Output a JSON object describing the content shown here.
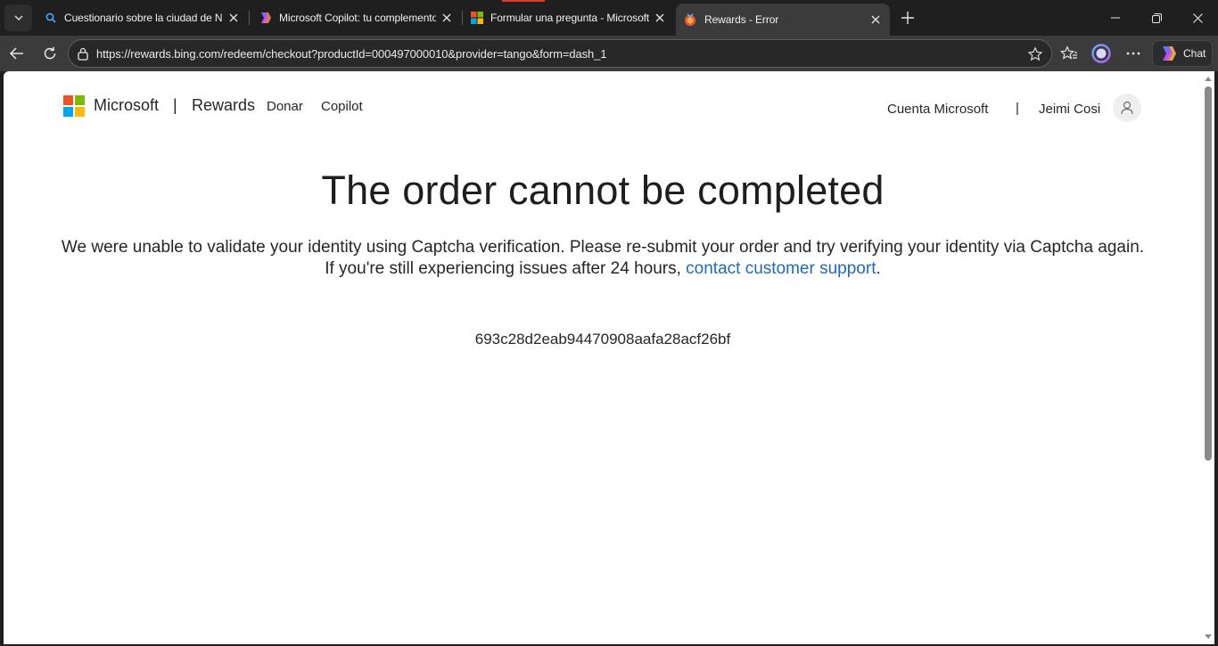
{
  "browser": {
    "tabs": [
      {
        "title": "Cuestionario sobre la ciudad de Nueva York",
        "icon": "bing-search-icon",
        "active": false
      },
      {
        "title": "Microsoft Copilot: tu complemento de IA",
        "icon": "copilot-icon",
        "active": false
      },
      {
        "title": "Formular una pregunta - Microsoft Community",
        "icon": "microsoft-logo-icon",
        "active": false
      },
      {
        "title": "Rewards - Error",
        "icon": "rewards-icon",
        "active": true
      }
    ],
    "address": {
      "url": "https://rewards.bing.com/redeem/checkout?productId=000497000010&provider=tango&form=dash_1"
    },
    "chat_label": "Chat"
  },
  "site": {
    "brand": "Microsoft",
    "separator": "|",
    "nav": {
      "rewards": "Rewards",
      "donar": "Donar",
      "copilot": "Copilot"
    },
    "account": {
      "link": "Cuenta Microsoft",
      "separator": "|",
      "user_name": "Jeimi Cosi"
    },
    "logo_colors": [
      "#f25022",
      "#7fba00",
      "#00a4ef",
      "#ffb900"
    ]
  },
  "main": {
    "title": "The order cannot be completed",
    "message_part1": "We were unable to validate your identity using Captcha verification. Please re-submit your order and try verifying your identity via Captcha again. If you're still experiencing issues after 24 hours, ",
    "support_link": "contact customer support",
    "message_end": ".",
    "reference_code": "693c28d2eab94470908aafa28acf26bf"
  },
  "colors": {
    "link": "#1f6bb5",
    "tab_accent": "#e03a2f"
  }
}
